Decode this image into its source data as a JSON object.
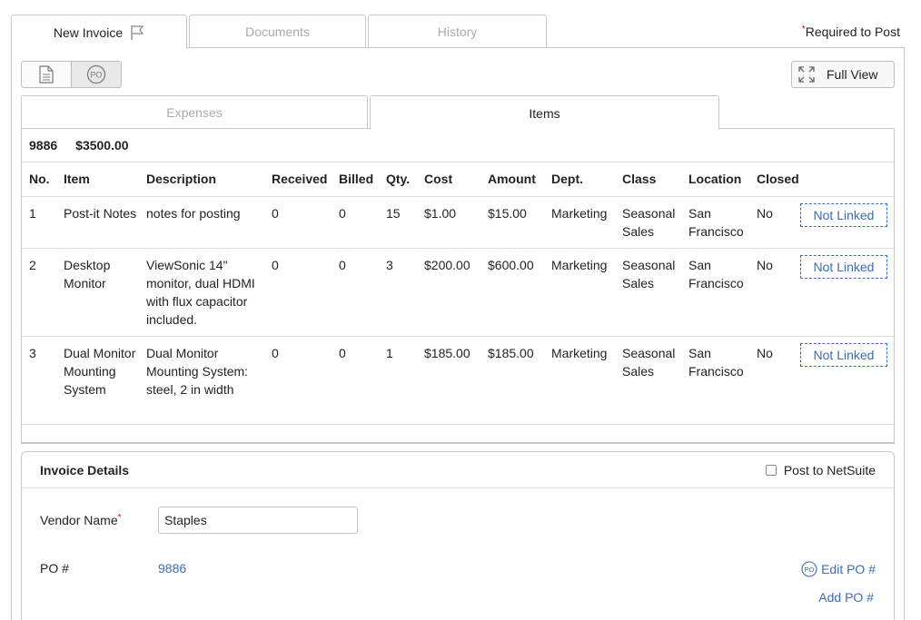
{
  "tabs": [
    {
      "label": "New Invoice"
    },
    {
      "label": "Documents"
    },
    {
      "label": "History"
    }
  ],
  "required_note": "Required to Post",
  "toolbar": {
    "full_view_label": "Full View",
    "po_icon_text": "PO"
  },
  "subtabs": [
    {
      "label": "Expenses"
    },
    {
      "label": "Items"
    }
  ],
  "summary": {
    "po_number": "9886",
    "total": "$3500.00"
  },
  "table": {
    "headers": [
      "No.",
      "Item",
      "Description",
      "Received",
      "Billed",
      "Qty.",
      "Cost",
      "Amount",
      "Dept.",
      "Class",
      "Location",
      "Closed",
      ""
    ],
    "rows": [
      {
        "no": "1",
        "item": "Post-it Notes",
        "description": "notes for posting",
        "received": "0",
        "billed": "0",
        "qty": "15",
        "cost": "$1.00",
        "amount": "$15.00",
        "dept": "Marketing",
        "class": "Seasonal Sales",
        "location": "San Francisco",
        "closed": "No",
        "link": "Not Linked"
      },
      {
        "no": "2",
        "item": "Desktop Monitor",
        "description": "ViewSonic 14\" monitor, dual HDMI with flux capacitor included.",
        "received": "0",
        "billed": "0",
        "qty": "3",
        "cost": "$200.00",
        "amount": "$600.00",
        "dept": "Marketing",
        "class": "Seasonal Sales",
        "location": "San Francisco",
        "closed": "No",
        "link": "Not Linked"
      },
      {
        "no": "3",
        "item": "Dual Monitor Mounting System",
        "description": "Dual Monitor Mounting System: steel, 2 in width",
        "received": "0",
        "billed": "0",
        "qty": "1",
        "cost": "$185.00",
        "amount": "$185.00",
        "dept": "Marketing",
        "class": "Seasonal Sales",
        "location": "San Francisco",
        "closed": "No",
        "link": "Not Linked"
      }
    ]
  },
  "details": {
    "title": "Invoice Details",
    "post_label": "Post to NetSuite",
    "vendor_label": "Vendor Name",
    "vendor_value": "Staples",
    "po_label": "PO #",
    "po_value": "9886",
    "edit_po": "Edit PO #",
    "add_po": "Add PO #"
  },
  "colors": {
    "link": "#3a6db5",
    "required": "#d0021b",
    "border": "#c9c9c9"
  }
}
